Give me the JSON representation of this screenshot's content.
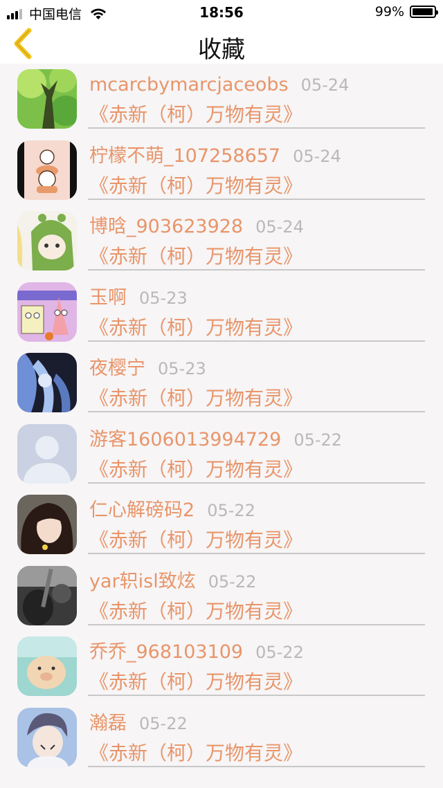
{
  "status_bar": {
    "carrier": "中国电信",
    "time": "18:56",
    "battery": "99%"
  },
  "nav": {
    "title": "收藏"
  },
  "colors": {
    "accent": "#e8956a",
    "date": "#b9b9b9",
    "back": "#f2c31b"
  },
  "items": [
    {
      "name": "mcarcbymarcjaceobs",
      "date": "05-24",
      "work": "《赤新（柯）万物有灵》",
      "avatar": "tree-avatar"
    },
    {
      "name": "柠檬不萌_107258657",
      "date": "05-24",
      "work": "《赤新（柯）万物有灵》",
      "avatar": "cartoon-bears-avatar"
    },
    {
      "name": "博晗_903623928",
      "date": "05-24",
      "work": "《赤新（柯）万物有灵》",
      "avatar": "anime-hood-avatar"
    },
    {
      "name": "玉啊",
      "date": "05-23",
      "work": "《赤新（柯）万物有灵》",
      "avatar": "spongebob-avatar"
    },
    {
      "name": "夜樱宁",
      "date": "05-23",
      "work": "《赤新（柯）万物有灵》",
      "avatar": "anime-girl-blue-avatar"
    },
    {
      "name": "游客1606013994729",
      "date": "05-22",
      "work": "《赤新（柯）万物有灵》",
      "avatar": "default-person-avatar"
    },
    {
      "name": "仁心解磅码2",
      "date": "05-22",
      "work": "《赤新（柯）万物有灵》",
      "avatar": "girl-photo-avatar"
    },
    {
      "name": "yar轵isl致炫",
      "date": "05-22",
      "work": "《赤新（柯）万物有灵》",
      "avatar": "guitar-photo-avatar"
    },
    {
      "name": "乔乔_968103109",
      "date": "05-22",
      "work": "《赤新（柯）万物有灵》",
      "avatar": "pig-avatar"
    },
    {
      "name": "瀚磊",
      "date": "05-22",
      "work": "《赤新（柯）万物有灵》",
      "avatar": "anime-boy-avatar"
    }
  ]
}
